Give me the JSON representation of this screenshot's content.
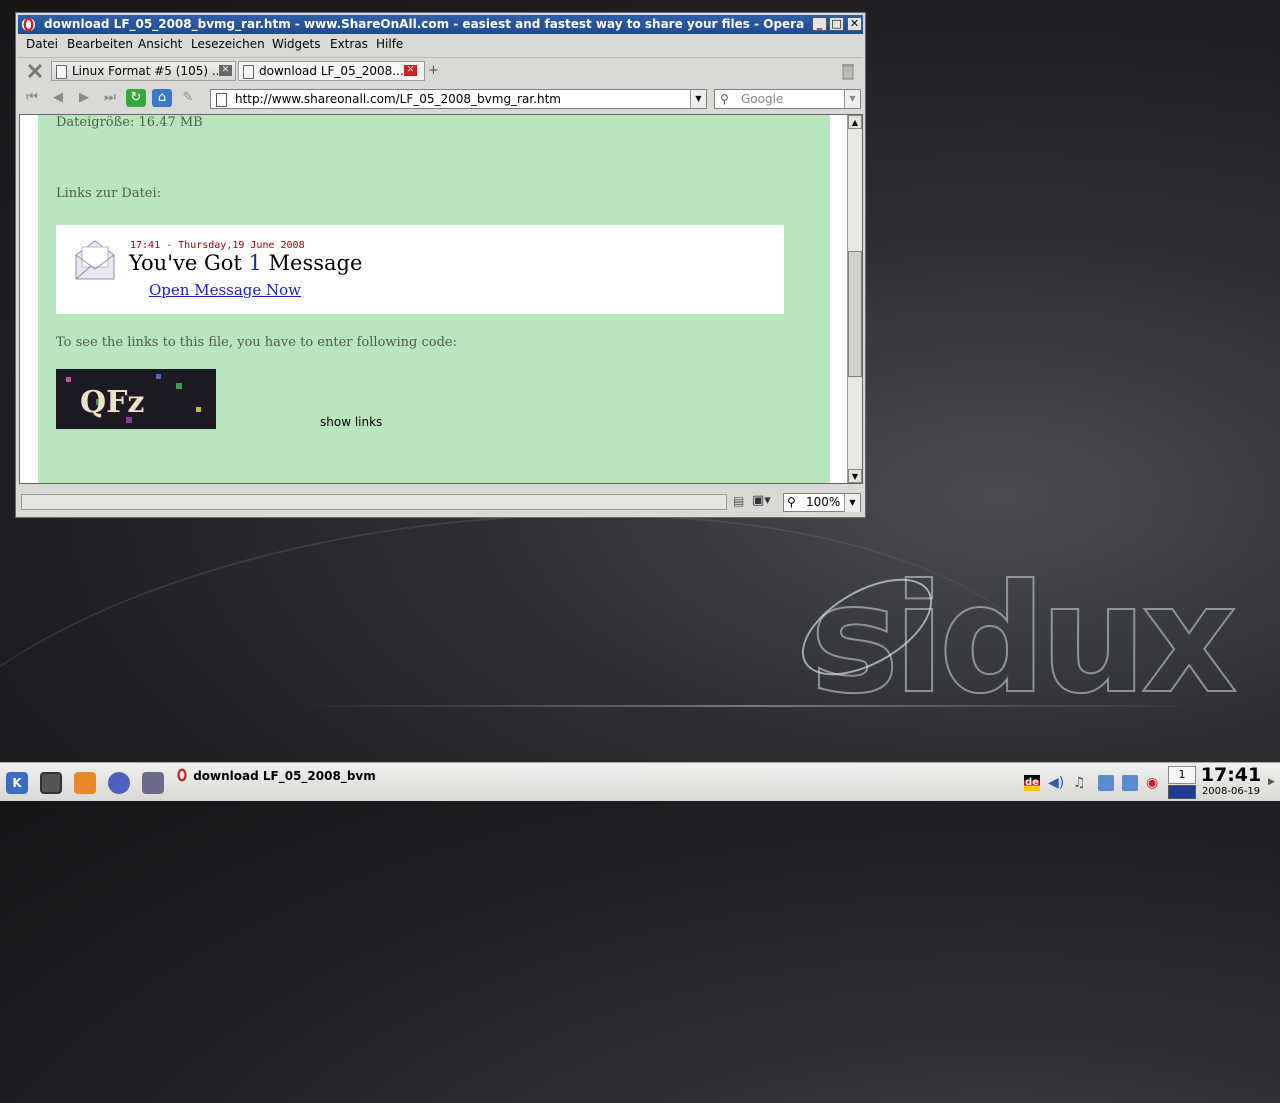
{
  "window": {
    "title": "download LF_05_2008_bvmg_rar.htm - www.ShareOnAll.com - easiest and fastest way to share your files - Opera",
    "controls": {
      "minimize": "_",
      "maximize": "□",
      "close": "✕"
    }
  },
  "menu": [
    "Datei",
    "Bearbeiten",
    "Ansicht",
    "Lesezeichen",
    "Widgets",
    "Extras",
    "Hilfe"
  ],
  "tabs": [
    {
      "label": "Linux Format #5 (105) ...",
      "active": false
    },
    {
      "label": "download LF_05_2008...",
      "active": true
    }
  ],
  "address": {
    "url": "http://www.shareonall.com/LF_05_2008_bvmg_rar.htm"
  },
  "search": {
    "placeholder": "Google"
  },
  "page": {
    "filesize": "Dateigröße: 16.47 MB",
    "links_heading": "Links zur Datei:",
    "ad": {
      "datetime": "17:41 - Thursday,19 June 2008",
      "headline_pre": "You've Got ",
      "headline_num": "1",
      "headline_post": " Message",
      "link": "Open Message Now"
    },
    "code_prompt": "To see the links to this file, you have to enter following code:",
    "captcha_text": "QFz",
    "show_links": "show links"
  },
  "statusbar": {
    "zoom": "100%"
  },
  "taskbar": {
    "task_title": "download LF_05_2008_bvm",
    "task_title_faded": "g",
    "pager_number": "1",
    "keyboard_layout": "de",
    "time": "17:41",
    "date": "2008-06-19"
  },
  "desktop": {
    "logo": "sidux"
  },
  "colors": {
    "titlebar": "#2f5ea8",
    "page_background": "#b7e6bf",
    "link": "#1a22cc"
  }
}
